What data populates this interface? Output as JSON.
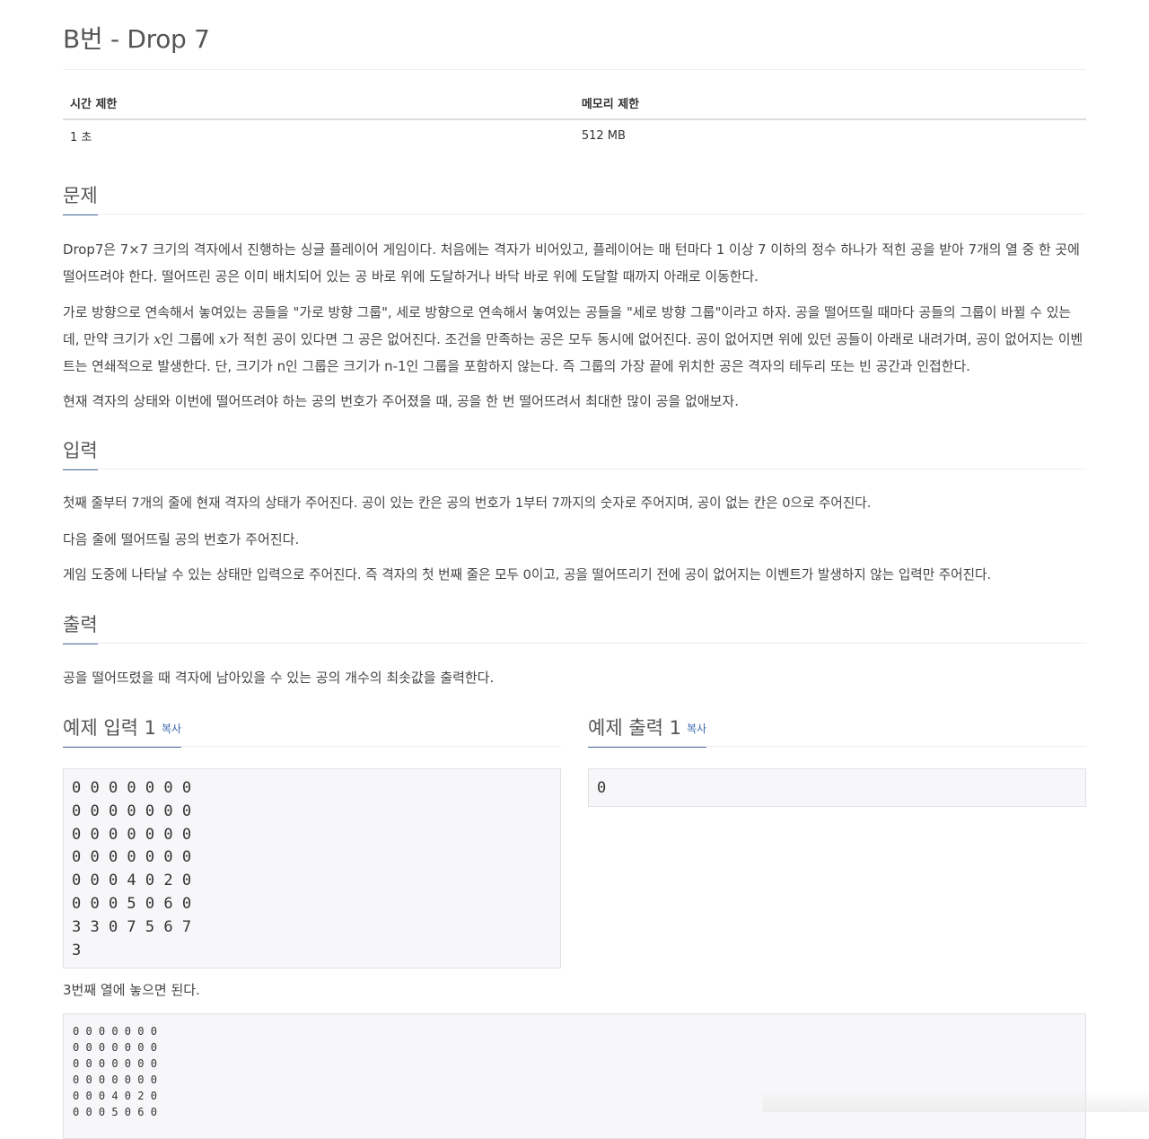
{
  "title": "B번 - Drop 7",
  "limits": {
    "headers": [
      "시간 제한",
      "메모리 제한"
    ],
    "values": [
      "1 초",
      "512 MB"
    ]
  },
  "sections": {
    "problem": {
      "heading": "문제",
      "p1": "Drop7은 7×7 크기의 격자에서 진행하는 싱글 플레이어 게임이다. 처음에는 격자가 비어있고, 플레이어는 매 턴마다 1 이상 7 이하의 정수 하나가 적힌 공을 받아 7개의 열 중 한 곳에 떨어뜨려야 한다. 떨어뜨린 공은 이미 배치되어 있는 공 바로 위에 도달하거나 바닥 바로 위에 도달할 때까지 아래로 이동한다.",
      "p2_a": "가로 방향으로 연속해서 놓여있는 공들을 \"가로 방향 그룹\", 세로 방향으로 연속해서 놓여있는 공들을 \"세로 방향 그룹\"이라고 하자. 공을 떨어뜨릴 때마다 공들의 그룹이 바뀔 수 있는데, 만약 크기가 ",
      "var_x": "x",
      "p2_b": "인 그룹에 ",
      "p2_c": "가 적힌 공이 있다면 그 공은 없어진다. 조건을 만족하는 공은 모두 동시에 없어진다. 공이 없어지면 위에 있던 공들이 아래로 내려가며, 공이 없어지는 이벤트는 연쇄적으로 발생한다. 단, 크기가 n인 그룹은 크기가 n-1인 그룹을 포함하지 않는다. 즉 그룹의 가장 끝에 위치한 공은 격자의 테두리 또는 빈 공간과 인접한다.",
      "p3": "현재 격자의 상태와 이번에 떨어뜨려야 하는 공의 번호가 주어졌을 때, 공을 한 번 떨어뜨려서 최대한 많이 공을 없애보자."
    },
    "input": {
      "heading": "입력",
      "p1": "첫째 줄부터 7개의 줄에 현재 격자의 상태가 주어진다. 공이 있는 칸은 공의 번호가 1부터 7까지의 숫자로 주어지며, 공이 없는 칸은 0으로 주어진다.",
      "p2": "다음 줄에 떨어뜨릴 공의 번호가 주어진다.",
      "p3": "게임 도중에 나타날 수 있는 상태만 입력으로 주어진다. 즉 격자의 첫 번째 줄은 모두 0이고, 공을 떨어뜨리기 전에 공이 없어지는 이벤트가 발생하지 않는 입력만 주어진다."
    },
    "output": {
      "heading": "출력",
      "p1": "공을 떨어뜨렸을 때 격자에 남아있을 수 있는 공의 개수의 최솟값을 출력한다."
    }
  },
  "samples": {
    "input_heading": "예제 입력 1",
    "output_heading": "예제 출력 1",
    "copy_label": "복사",
    "input_text": "0 0 0 0 0 0 0\n0 0 0 0 0 0 0\n0 0 0 0 0 0 0\n0 0 0 0 0 0 0\n0 0 0 4 0 2 0\n0 0 0 5 0 6 0\n3 3 0 7 5 6 7\n3",
    "output_text": "0",
    "explanation": "3번째 열에 놓으면 된다.",
    "explain_grid": "0 0 0 0 0 0 0\n0 0 0 0 0 0 0\n0 0 0 0 0 0 0\n0 0 0 0 0 0 0\n0 0 0 4 0 2 0\n0 0 0 5 0 6 0"
  }
}
